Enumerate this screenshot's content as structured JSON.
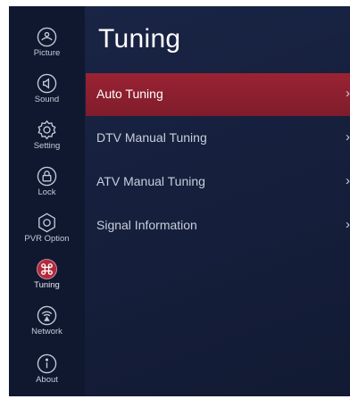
{
  "sidebar": {
    "items": [
      {
        "label": "Picture",
        "icon": "picture-icon"
      },
      {
        "label": "Sound",
        "icon": "sound-icon"
      },
      {
        "label": "Setting",
        "icon": "setting-icon"
      },
      {
        "label": "Lock",
        "icon": "lock-icon"
      },
      {
        "label": "PVR Option",
        "icon": "pvr-option-icon"
      },
      {
        "label": "Tuning",
        "icon": "tuning-icon",
        "selected": true
      },
      {
        "label": "Network",
        "icon": "network-icon"
      },
      {
        "label": "About",
        "icon": "about-icon"
      }
    ]
  },
  "main": {
    "title": "Tuning",
    "menu": [
      {
        "label": "Auto Tuning",
        "selected": true
      },
      {
        "label": "DTV Manual Tuning"
      },
      {
        "label": "ATV Manual Tuning"
      },
      {
        "label": "Signal Information"
      }
    ],
    "chevron": "›"
  },
  "colors": {
    "accent": "#8e2030",
    "background": "#16203d",
    "sidebar": "#101830"
  }
}
